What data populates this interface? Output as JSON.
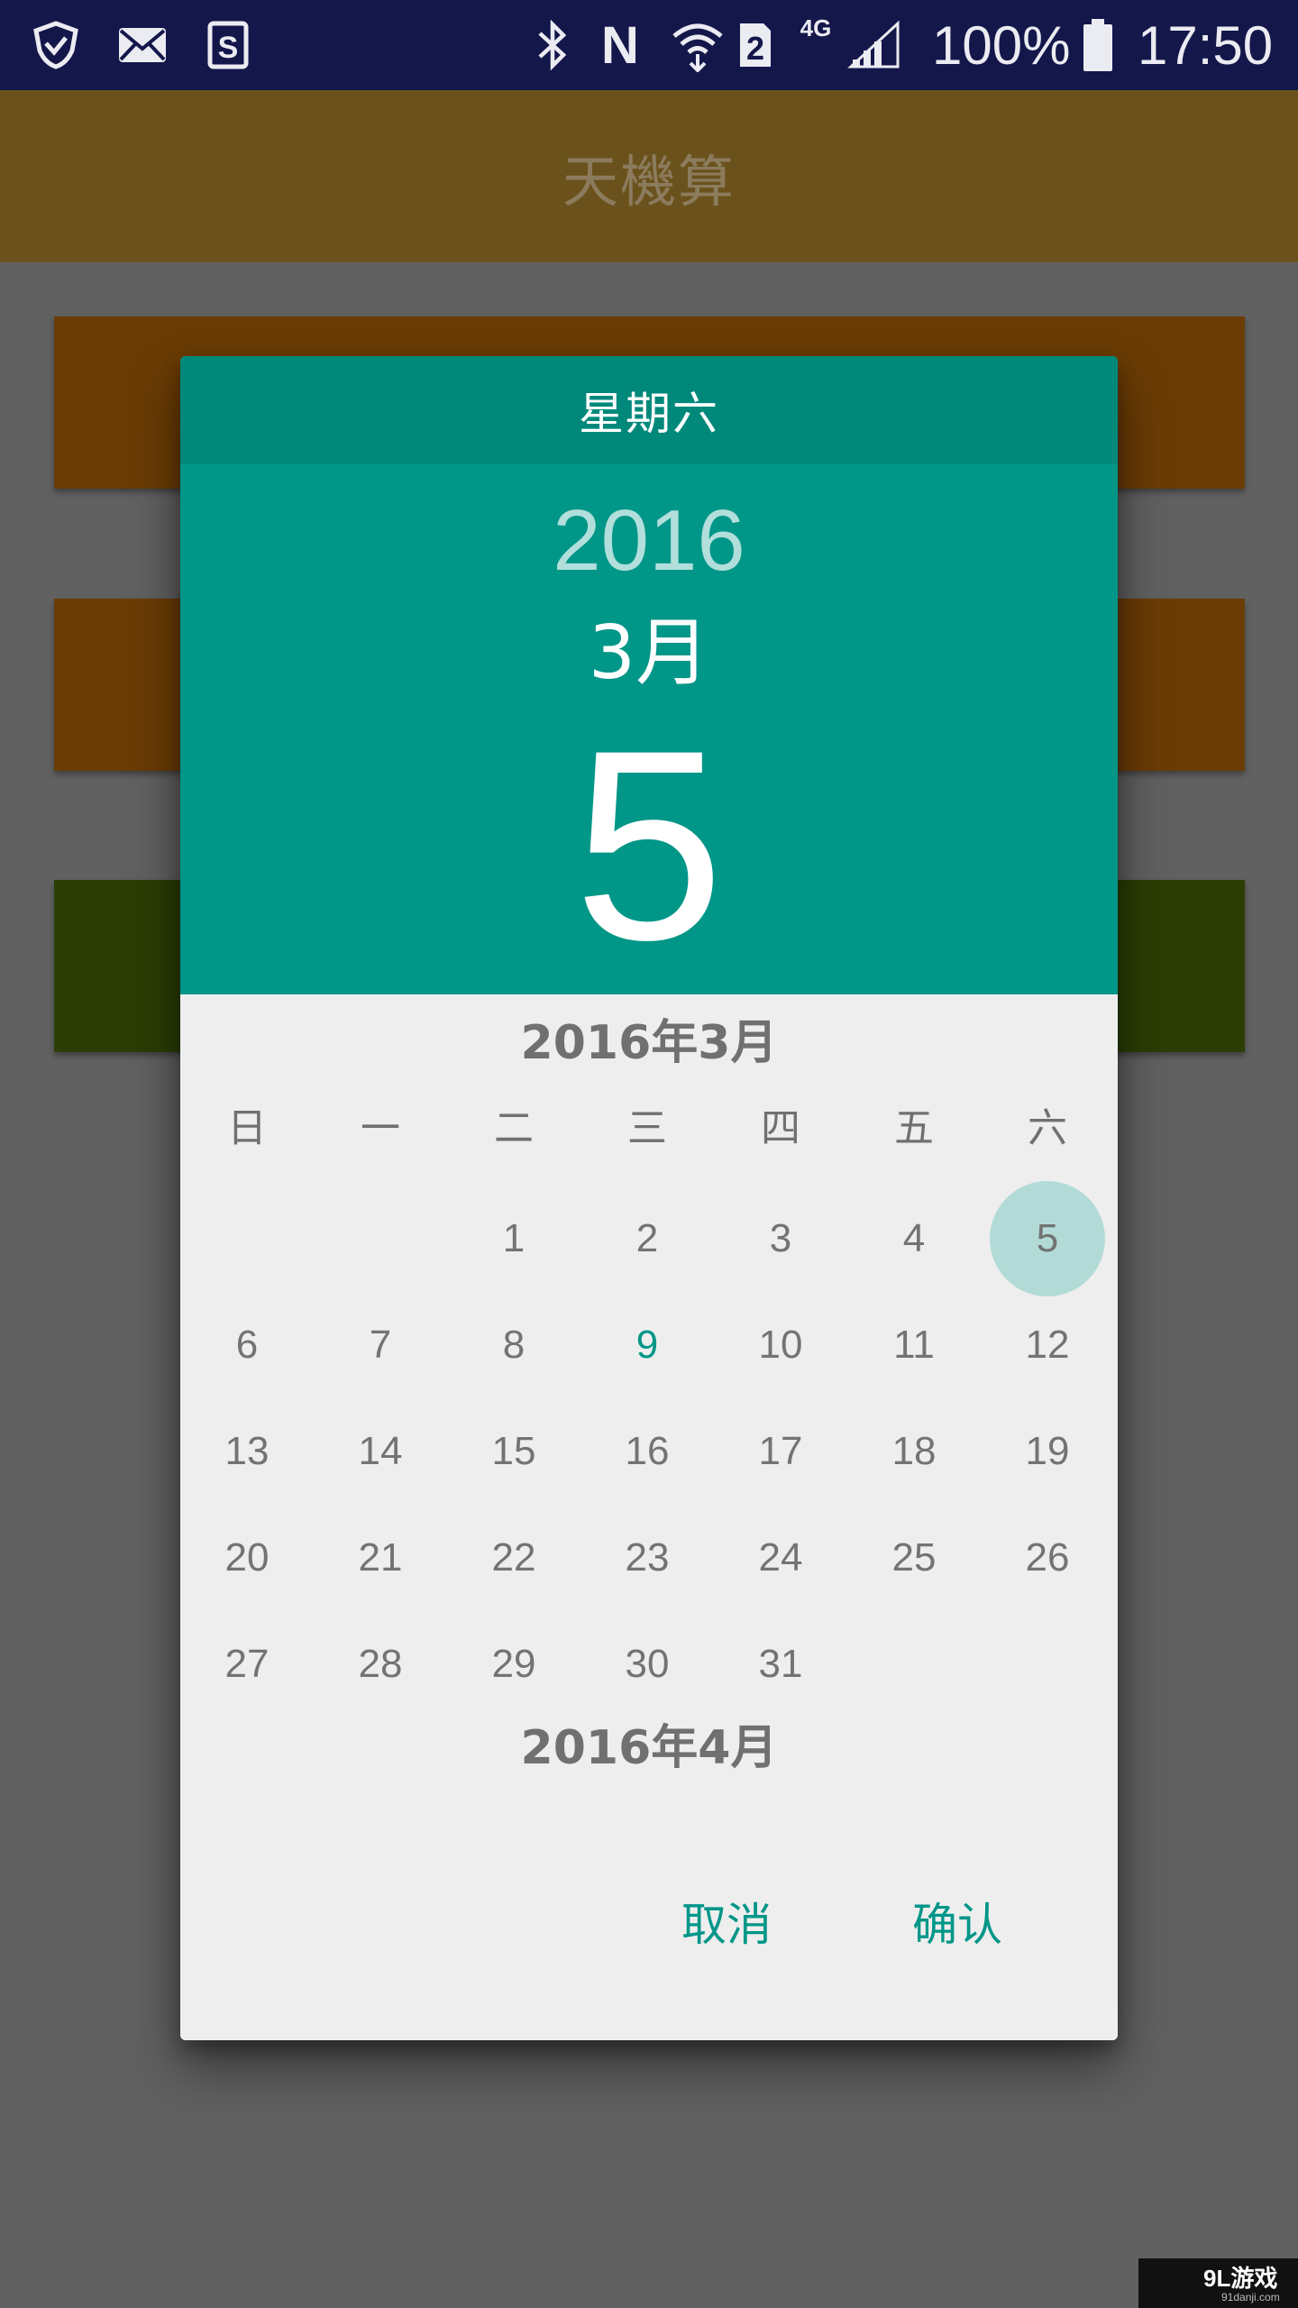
{
  "status_bar": {
    "battery": "100%",
    "time": "17:50",
    "sim_slot": "2",
    "network_type": "4G",
    "nfc": "N",
    "icons": [
      "shield-icon",
      "mail-icon",
      "sim-app-icon",
      "bluetooth-icon",
      "nfc-icon",
      "wifi-icon",
      "sim2-icon",
      "signal-icon",
      "battery-icon"
    ]
  },
  "app": {
    "title": "天機算"
  },
  "dialog": {
    "weekday": "星期六",
    "year": "2016",
    "month": "3月",
    "day": "5",
    "current_month_title": "2016年3月",
    "next_month_title": "2016年4月",
    "weekday_headers": [
      "日",
      "一",
      "二",
      "三",
      "四",
      "五",
      "六"
    ],
    "first_weekday_index": 2,
    "days_in_month": 31,
    "selected_day": 5,
    "today_day": 9,
    "cancel_label": "取消",
    "confirm_label": "确认"
  },
  "colors": {
    "accent": "#009688",
    "accent_dark": "#00897b",
    "selected_circle": "#b2dbd7",
    "status_bar_bg": "#14174a"
  },
  "watermark": {
    "brand": "9L游戏",
    "site": "91danji.com"
  }
}
